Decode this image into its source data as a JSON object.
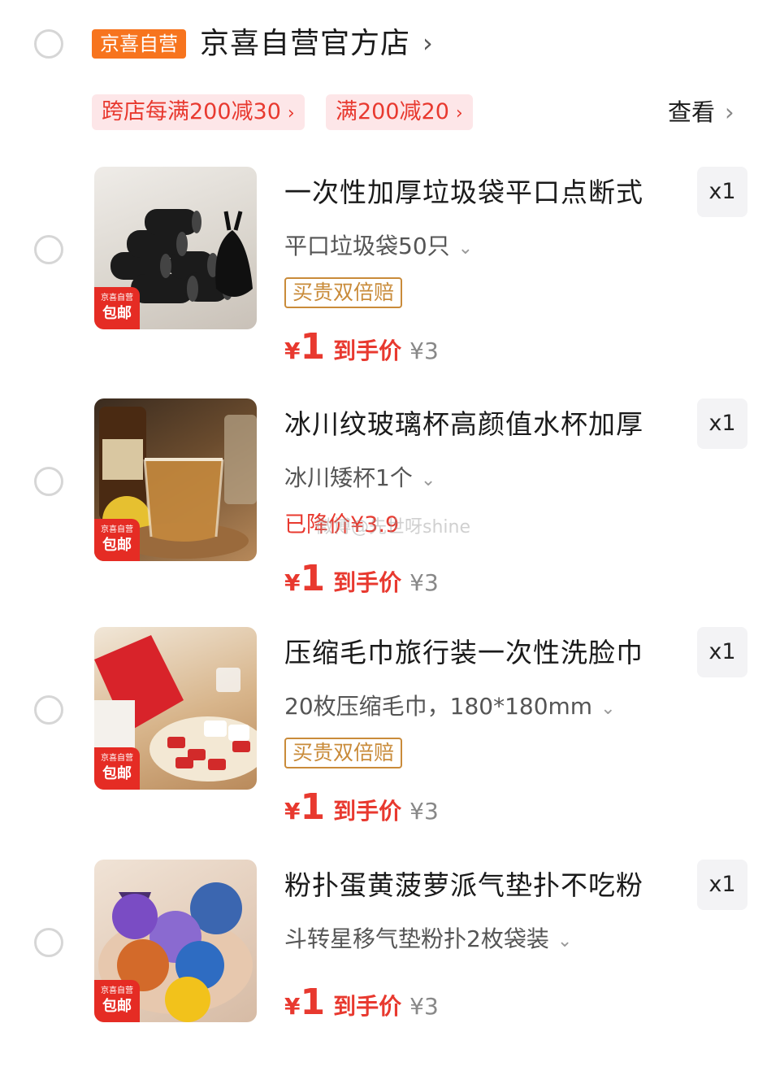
{
  "store": {
    "badge": "京喜自营",
    "name": "京喜自营官方店",
    "arrow": "›"
  },
  "promos": [
    {
      "label": "跨店每满200减30",
      "chev": "›"
    },
    {
      "label": "满200减20",
      "chev": "›"
    }
  ],
  "view_more": {
    "label": "查看",
    "chev": "›"
  },
  "thumb_tag": {
    "line1": "京喜自营",
    "line2": "包邮"
  },
  "watermark": "微博@先世呀shine",
  "items": [
    {
      "title": "一次性加厚垃圾袋平口点断式",
      "spec": "平口垃圾袋50只",
      "chev": "⌄",
      "guarantee": "买贵双倍赔",
      "dropped": "",
      "yen": "¥",
      "price": "1",
      "price_label": "到手价",
      "orig_price": "¥3",
      "qty": "x1"
    },
    {
      "title": "冰川纹玻璃杯高颜值水杯加厚",
      "spec": "冰川矮杯1个",
      "chev": "⌄",
      "guarantee": "",
      "dropped": "已降价¥3.9",
      "yen": "¥",
      "price": "1",
      "price_label": "到手价",
      "orig_price": "¥3",
      "qty": "x1"
    },
    {
      "title": "压缩毛巾旅行装一次性洗脸巾",
      "spec": "20枚压缩毛巾，180*180mm",
      "chev": "⌄",
      "guarantee": "买贵双倍赔",
      "dropped": "",
      "yen": "¥",
      "price": "1",
      "price_label": "到手价",
      "orig_price": "¥3",
      "qty": "x1"
    },
    {
      "title": "粉扑蛋黄菠萝派气垫扑不吃粉",
      "spec": "斗转星移气垫粉扑2枚袋装",
      "chev": "⌄",
      "guarantee": "",
      "dropped": "",
      "yen": "¥",
      "price": "1",
      "price_label": "到手价",
      "orig_price": "¥3",
      "qty": "x1"
    }
  ],
  "colors": {
    "accent_red": "#e8392f",
    "store_orange": "#f7741e",
    "guarantee_gold": "#c98b3a"
  }
}
